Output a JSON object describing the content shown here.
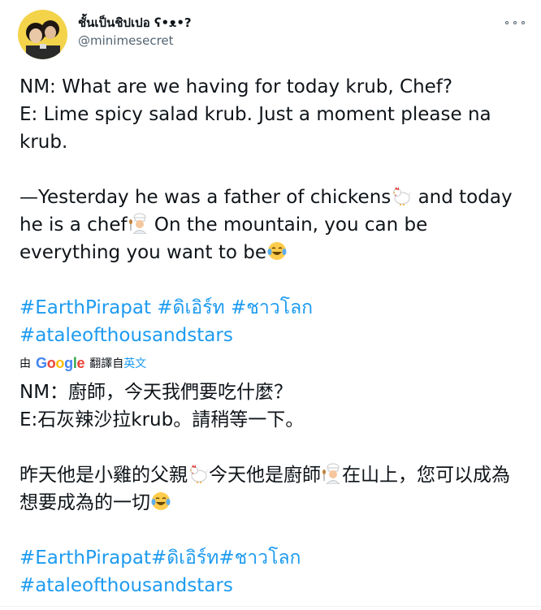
{
  "tweet": {
    "author": {
      "display_name": "ชั้นเป็นชิปเปอ ʕ•ᴥ•?",
      "handle": "@minimesecret"
    },
    "lines": [
      "NM: What are we having for today krub, Chef?",
      "E: Lime spicy salad krub. Just a moment please na krub.",
      "—Yesterday he was a father of chickens",
      " and today he is a chef",
      " On the mountain, you can be everything you want to be"
    ],
    "hashtags_line1": [
      "#EarthPirapat",
      "#ดิเอิร์ท",
      "#ชาวโลก"
    ],
    "hashtags_line2": [
      "#ataleofthousandstars"
    ],
    "icons": {
      "rooster": "rooster-icon",
      "chef": "cook-icon",
      "laugh": "face-with-tears-of-joy-icon",
      "more": "more-options-icon"
    }
  },
  "translation_bar": {
    "prefix": "由",
    "provider": "Google",
    "action": "翻譯自",
    "language": "英文"
  },
  "translation": {
    "lines": [
      "NM：廚師，今天我們要吃什麼？",
      "E:石灰辣沙拉krub。請稍等一下。",
      "昨天他是小雞的父親",
      "今天他是廚師",
      "在山上，您可以成為想要成為的一切"
    ],
    "hashtags_line1": [
      "#EarthPirapat",
      "#ดิเอิร์ท",
      "#ชาวโลก"
    ],
    "hashtags_line2": [
      "#ataleofthousandstars"
    ]
  },
  "colors": {
    "link": "#1d9bf0",
    "text": "#0f1419",
    "secondary": "#536471"
  }
}
